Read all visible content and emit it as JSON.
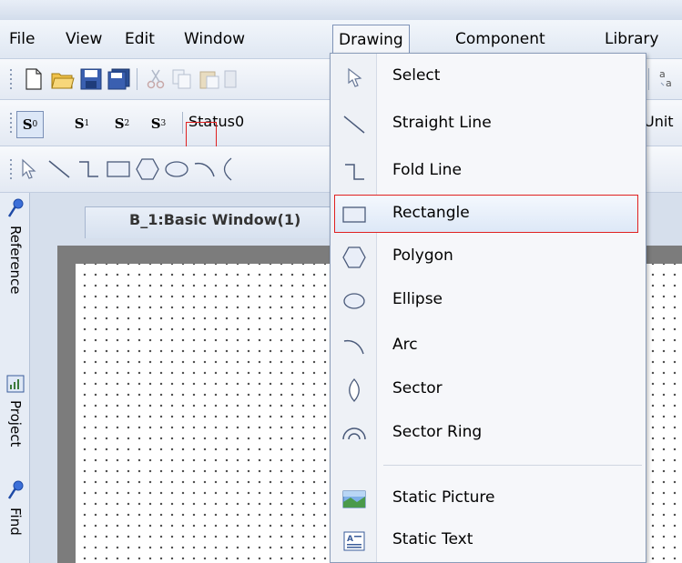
{
  "menubar": {
    "items": [
      "File",
      "View",
      "Edit",
      "Window",
      "Drawing",
      "Component",
      "Library"
    ]
  },
  "state_toolbar": {
    "states": [
      {
        "main": "S",
        "sub": "0"
      },
      {
        "main": "S",
        "sub": "1"
      },
      {
        "main": "S",
        "sub": "2"
      },
      {
        "main": "S",
        "sub": "3"
      }
    ],
    "status_value": "Status0",
    "unit_label": "Unit"
  },
  "left_panel": {
    "tabs": [
      "Reference",
      "Project",
      "Find"
    ]
  },
  "document": {
    "tab_title": "B_1:Basic Window(1)"
  },
  "drawing_menu": {
    "items": [
      {
        "label": "Select",
        "icon": "cursor-icon"
      },
      {
        "label": "Straight Line",
        "icon": "line-icon"
      },
      {
        "label": "Fold Line",
        "icon": "fold-line-icon"
      },
      {
        "label": "Rectangle",
        "icon": "rectangle-icon"
      },
      {
        "label": "Polygon",
        "icon": "polygon-icon"
      },
      {
        "label": "Ellipse",
        "icon": "ellipse-icon"
      },
      {
        "label": "Arc",
        "icon": "arc-icon"
      },
      {
        "label": "Sector",
        "icon": "sector-icon"
      },
      {
        "label": "Sector Ring",
        "icon": "sector-ring-icon"
      },
      {
        "label": "Static Picture",
        "icon": "picture-icon"
      },
      {
        "label": "Static Text",
        "icon": "text-icon"
      }
    ],
    "highlighted": "Rectangle",
    "highlight_color": "#e02020"
  }
}
